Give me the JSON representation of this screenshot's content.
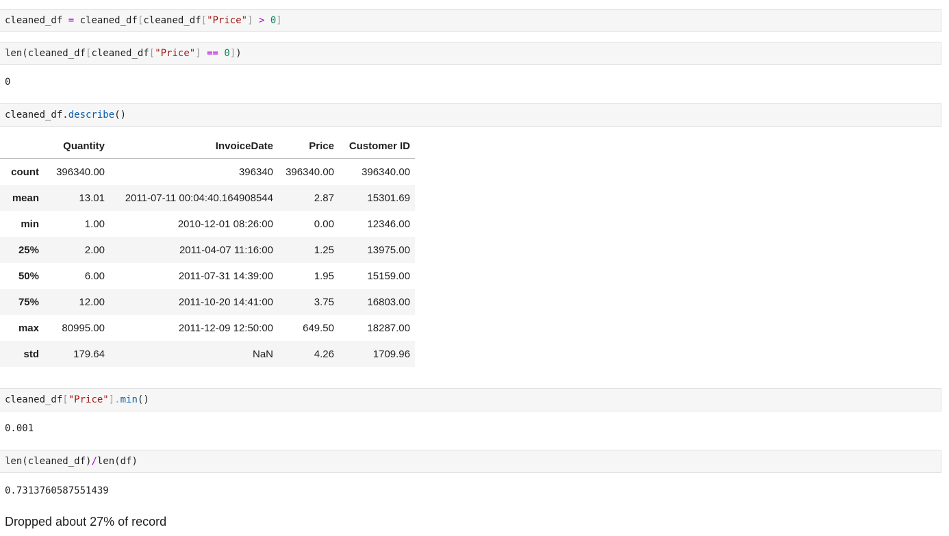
{
  "cells": {
    "c1": {
      "var": "cleaned_df",
      "assign": "=",
      "var2": "cleaned_df",
      "open": "[",
      "var3": "cleaned_df",
      "open2": "[",
      "key": "\"Price\"",
      "close2": "]",
      "op": ">",
      "num": "0",
      "close": "]"
    },
    "c2": {
      "fn_len": "len(",
      "var": "cleaned_df",
      "open": "[",
      "var2": "cleaned_df",
      "open2": "[",
      "key": "\"Price\"",
      "close2": "]",
      "op": "==",
      "num": "0",
      "close": "]",
      "paren": ")",
      "output": "0"
    },
    "c3": {
      "var": "cleaned_df.",
      "method": "describe",
      "parens": "()"
    },
    "c4": {
      "var": "cleaned_df",
      "open": "[",
      "key": "\"Price\"",
      "close": "].",
      "method": "min",
      "parens": "()",
      "output": "0.001"
    },
    "c5": {
      "fn1": "len(cleaned_df)",
      "op": "/",
      "fn2": "len(df)",
      "output": "0.7313760587551439"
    }
  },
  "describe_table": {
    "columns": [
      "Quantity",
      "InvoiceDate",
      "Price",
      "Customer ID"
    ],
    "rows": [
      {
        "index": "count",
        "values": [
          "396340.00",
          "396340",
          "396340.00",
          "396340.00"
        ]
      },
      {
        "index": "mean",
        "values": [
          "13.01",
          "2011-07-11 00:04:40.164908544",
          "2.87",
          "15301.69"
        ]
      },
      {
        "index": "min",
        "values": [
          "1.00",
          "2010-12-01 08:26:00",
          "0.00",
          "12346.00"
        ]
      },
      {
        "index": "25%",
        "values": [
          "2.00",
          "2011-04-07 11:16:00",
          "1.25",
          "13975.00"
        ]
      },
      {
        "index": "50%",
        "values": [
          "6.00",
          "2011-07-31 14:39:00",
          "1.95",
          "15159.00"
        ]
      },
      {
        "index": "75%",
        "values": [
          "12.00",
          "2011-10-20 14:41:00",
          "3.75",
          "16803.00"
        ]
      },
      {
        "index": "max",
        "values": [
          "80995.00",
          "2011-12-09 12:50:00",
          "649.50",
          "18287.00"
        ]
      },
      {
        "index": "std",
        "values": [
          "179.64",
          "NaN",
          "4.26",
          "1709.96"
        ]
      }
    ]
  },
  "markdown": {
    "text": "Dropped about 27% of record"
  },
  "colors": {
    "code_bg": "#f6f6f6",
    "keyword_op": "#af00db",
    "number": "#098658",
    "string": "#a31515",
    "function": "#0b5cad"
  }
}
